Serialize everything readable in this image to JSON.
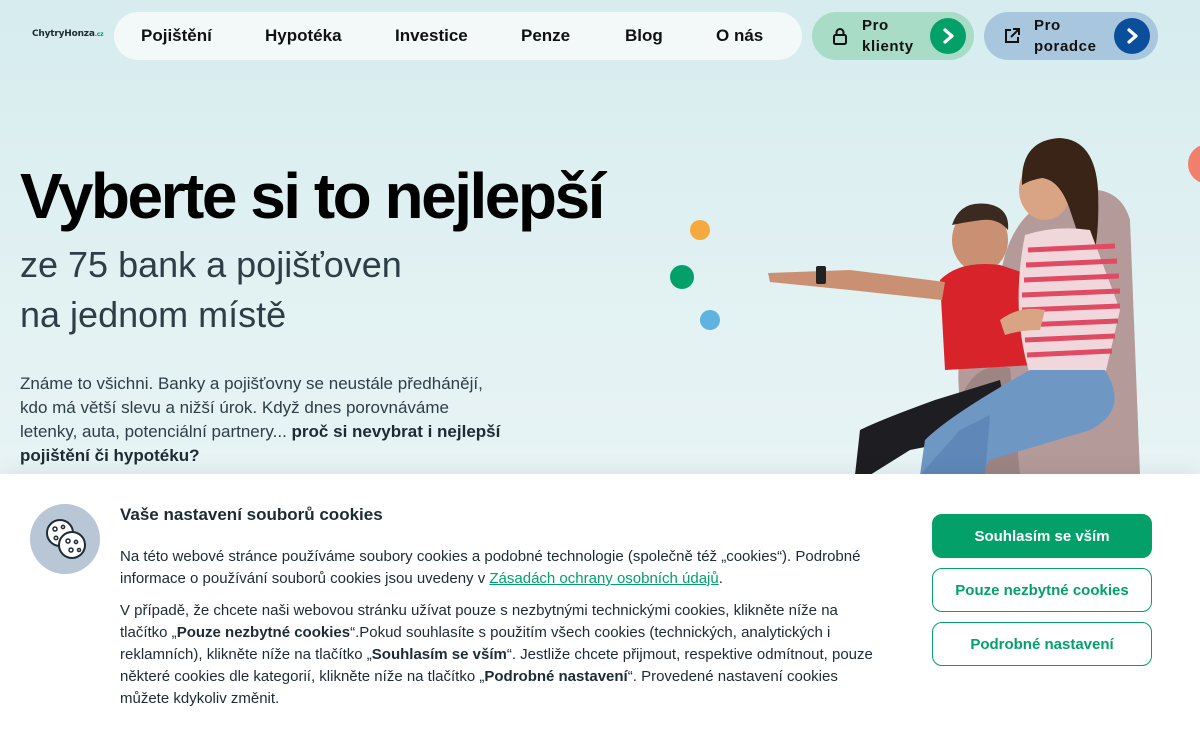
{
  "logo": {
    "text": "ChytryHonza",
    "suffix": ".cz"
  },
  "nav": {
    "items": [
      "Pojištění",
      "Hypotéka",
      "Investice",
      "Penze",
      "Blog",
      "O nás"
    ]
  },
  "header_actions": {
    "clients_label": "Pro klienty",
    "advisors_label": "Pro poradce",
    "clients_icon": "lock-icon",
    "advisors_icon": "external-link-icon"
  },
  "hero": {
    "title": "Vyberte si to nejlepší",
    "subtitle_line1": "ze 75 bank a pojišťoven",
    "subtitle_line2": "na jednom místě",
    "text_plain": "Známe to všichni. Banky a pojišťovny se neustále předhánějí, kdo má větší slevu a nižší úrok. Když dnes porovnáváme letenky, auta, potenciální partnery...",
    "text_bold": "proč si nevybrat i nejlepší pojištění či hypotéku?"
  },
  "colors": {
    "brand_green": "#03a06a",
    "brand_blue": "#0b4f9c",
    "dot_orange": "#f5a93e",
    "dot_blue": "#5fb3e0",
    "dot_coral": "#f07f6c"
  },
  "cookie": {
    "icon": "cookie-icon",
    "title": "Vaše nastavení souborů cookies",
    "p1_text": "Na této webové stránce používáme soubory cookies a podobné technologie (společně též „cookies“). Podrobné informace o používání souborů cookies jsou uvedeny v ",
    "p1_link": "Zásadách ochrany osobních údajů",
    "p1_end": ".",
    "p2_a": "V případě, že chcete naši webovou stránku užívat pouze s nezbytnými technickými cookies, klikněte níže na tlačítko „",
    "p2_b": "Pouze nezbytné cookies",
    "p2_c": "“.Pokud souhlasíte s použitím všech cookies (technických, analytických i reklamních), klikněte níže na tlačítko „",
    "p2_d": "Souhlasím se vším",
    "p2_e": "“. Jestliže chcete přijmout, respektive odmítnout, pouze některé cookies dle kategorií, klikněte níže na tlačítko „",
    "p2_f": "Podrobné nastavení",
    "p2_g": "“. Provedené nastavení cookies můžete kdykoliv změnit.",
    "accept_label": "Souhlasím se vším",
    "necessary_label": "Pouze nezbytné cookies",
    "settings_label": "Podrobné nastavení"
  }
}
